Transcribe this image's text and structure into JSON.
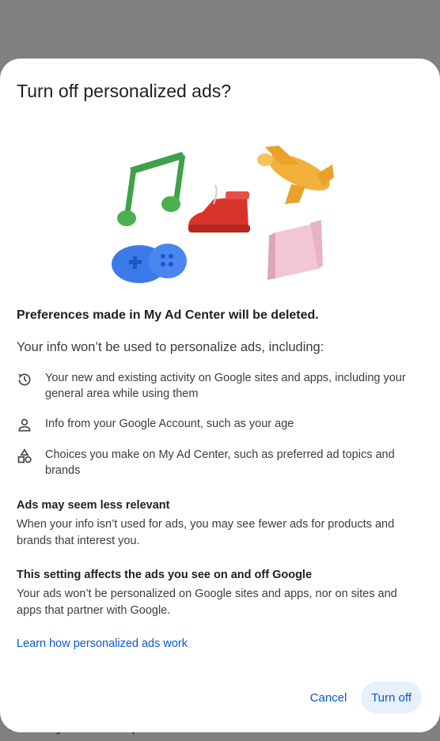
{
  "background": {
    "peek_text": "Activity used to personalize ads"
  },
  "dialog": {
    "title": "Turn off personalized ads?",
    "headline": "Preferences made in My Ad Center will be deleted.",
    "intro": "Your info won’t be used to personalize ads, including:",
    "items": [
      {
        "icon": "history-icon",
        "text": "Your new and existing activity on Google sites and apps, including your general area while using them"
      },
      {
        "icon": "person-icon",
        "text": "Info from your Google Account, such as your age"
      },
      {
        "icon": "shapes-icon",
        "text": "Choices you make on My Ad Center, such as preferred ad topics and brands"
      }
    ],
    "sections": [
      {
        "heading": "Ads may seem less relevant",
        "body": "When your info isn’t used for ads, you may see fewer ads for products and brands that interest you."
      },
      {
        "heading": "This setting affects the ads you see on and off Google",
        "body": "Your ads won’t be personalized on Google sites and apps, nor on sites and apps that partner with Google."
      }
    ],
    "learn_link": "Learn how personalized ads work",
    "buttons": {
      "cancel": "Cancel",
      "turn_off": "Turn off"
    }
  },
  "colors": {
    "accent": "#0b57d0",
    "primary_tonal": "#e8f0fe",
    "scrim": "#808080"
  }
}
